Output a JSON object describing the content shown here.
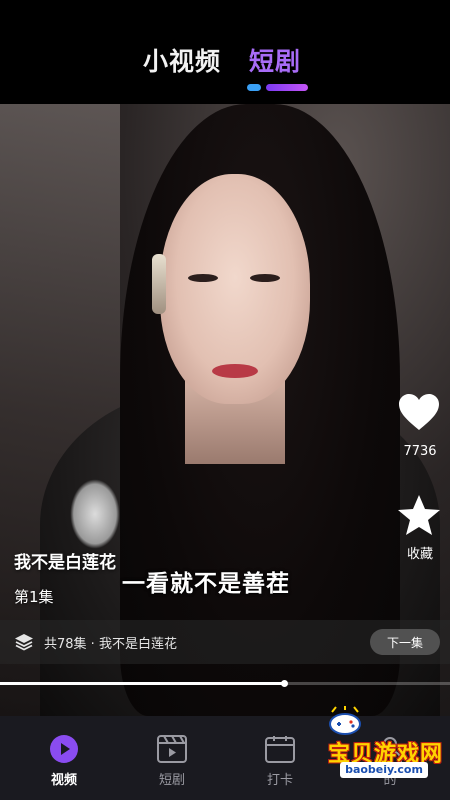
{
  "top_tabs": [
    {
      "label": "小视频",
      "active": false
    },
    {
      "label": "短剧",
      "active": true
    }
  ],
  "video": {
    "subtitle": "一看就不是善茬",
    "drama_title": "我不是白莲花",
    "episode": "第1集",
    "progress": 0.63
  },
  "actions": {
    "like_count": "7736",
    "favorite_label": "收藏"
  },
  "series_bar": {
    "text": "共78集 · 我不是白莲花",
    "next_label": "下一集"
  },
  "bottom_nav": [
    {
      "label": "视频",
      "icon": "play-circle-icon",
      "active": true
    },
    {
      "label": "短剧",
      "icon": "clapperboard-icon",
      "active": false
    },
    {
      "label": "打卡",
      "icon": "checkin-icon",
      "active": false
    },
    {
      "label": "的",
      "icon": "user-icon",
      "active": false
    }
  ],
  "watermark": {
    "title": "宝贝游戏网",
    "url": "baobeiy.com"
  },
  "colors": {
    "accent_purple": "#a86cf7",
    "accent_blue": "#3aa0f5",
    "nav_bg": "#1a1a20"
  }
}
